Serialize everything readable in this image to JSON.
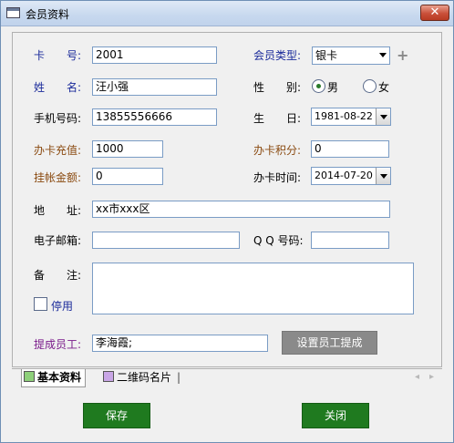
{
  "window": {
    "title": "会员资料",
    "close_glyph": "✕"
  },
  "form": {
    "card_no": {
      "label": "卡　　号:",
      "value": "2001"
    },
    "member_type": {
      "label": "会员类型:",
      "value": "银卡",
      "add_glyph": "+"
    },
    "name": {
      "label": "姓　　名:",
      "value": "汪小强"
    },
    "gender": {
      "label": "性　　别:",
      "options": [
        "男",
        "女"
      ],
      "selected": "男"
    },
    "phone": {
      "label": "手机号码:",
      "value": "13855556666"
    },
    "birthday": {
      "label": "生　　日:",
      "value": "1981-08-22"
    },
    "card_recharge": {
      "label": "办卡充值:",
      "value": "1000"
    },
    "card_points": {
      "label": "办卡积分:",
      "value": "0"
    },
    "credit_amount": {
      "label": "挂帐金额:",
      "value": "0"
    },
    "card_time": {
      "label": "办卡时间:",
      "value": "2014-07-20"
    },
    "address": {
      "label": "地　　址:",
      "value": "xx市xxx区"
    },
    "email": {
      "label": "电子邮箱:",
      "value": ""
    },
    "qq": {
      "label": "Q Q 号码:",
      "value": ""
    },
    "remarks": {
      "label": "备　　注:",
      "value": ""
    },
    "disabled": {
      "label": "停用",
      "checked": false
    },
    "commission_staff": {
      "label": "提成员工:",
      "value": "李海霞;"
    },
    "set_commission_button": "设置员工提成"
  },
  "tabs": [
    {
      "label": "基本资料",
      "active": true,
      "color": "#8ed07a"
    },
    {
      "label": "二维码名片",
      "active": false,
      "color": "#c9a6e6"
    }
  ],
  "tab_scroll": {
    "left": "◂",
    "right": "▸"
  },
  "buttons": {
    "save": "保存",
    "close": "关闭"
  }
}
